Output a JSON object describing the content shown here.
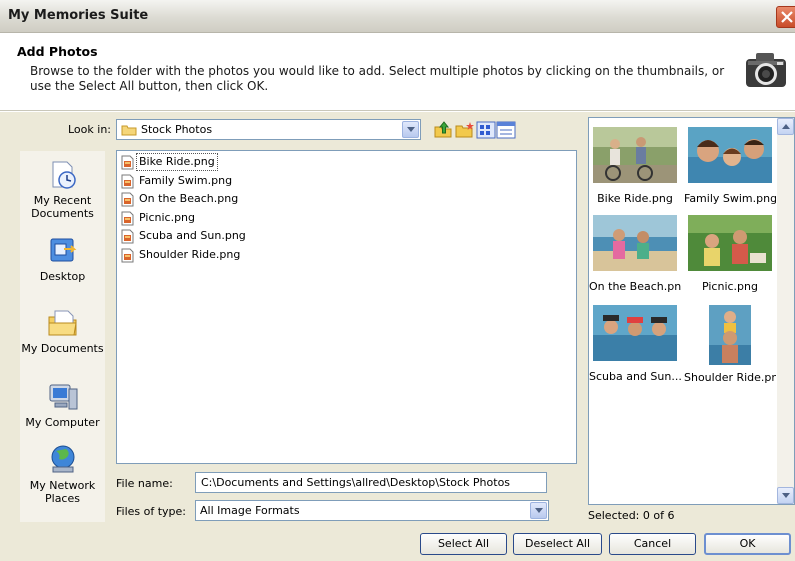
{
  "window": {
    "title": "My Memories Suite"
  },
  "header": {
    "title": "Add Photos",
    "description": "Browse to the folder with the photos you would like to add. Select multiple photos by clicking on the thumbnails, or use the Select All button, then click OK."
  },
  "look_in": {
    "label": "Look in:",
    "value": "Stock Photos"
  },
  "places": [
    {
      "label": "My Recent Documents",
      "icon": "recent-documents-icon"
    },
    {
      "label": "Desktop",
      "icon": "desktop-icon"
    },
    {
      "label": "My Documents",
      "icon": "my-documents-icon"
    },
    {
      "label": "My Computer",
      "icon": "my-computer-icon"
    },
    {
      "label": "My Network Places",
      "icon": "network-places-icon"
    }
  ],
  "files": [
    "Bike Ride.png",
    "Family Swim.png",
    "On the Beach.png",
    "Picnic.png",
    "Scuba and Sun.png",
    "Shoulder Ride.png"
  ],
  "file_name": {
    "label": "File name:",
    "value": "C:\\Documents and Settings\\allred\\Desktop\\Stock Photos"
  },
  "file_type": {
    "label": "Files of type:",
    "value": "All Image Formats"
  },
  "thumbnails": [
    "Bike Ride.png",
    "Family Swim.png",
    "On the Beach.png",
    "Picnic.png",
    "Scuba and Sun....",
    "Shoulder Ride.png"
  ],
  "selected_status": "Selected: 0 of 6",
  "buttons": {
    "select_all": "Select All",
    "deselect_all": "Deselect All",
    "cancel": "Cancel",
    "ok": "OK"
  },
  "colors": {
    "dialog_bg": "#ece9d8",
    "field_border": "#7f9db9",
    "close_red": "#c94c2a"
  }
}
